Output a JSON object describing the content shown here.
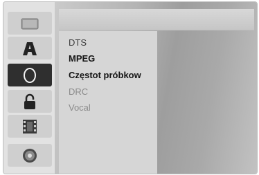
{
  "sidebar": {
    "items": [
      {
        "icon": "folder-icon",
        "active": false
      },
      {
        "icon": "audio-language-a-icon",
        "active": false
      },
      {
        "icon": "circle-audio-icon",
        "active": true
      },
      {
        "icon": "lock-icon",
        "active": false
      },
      {
        "icon": "film-strip-icon",
        "active": false
      },
      {
        "icon": "disc-icon",
        "active": false
      }
    ]
  },
  "submenu": {
    "items": [
      {
        "label": "DTS",
        "state": "enabled"
      },
      {
        "label": "MPEG",
        "state": "selected"
      },
      {
        "label": "Częstot próbkow",
        "state": "selected"
      },
      {
        "label": "DRC",
        "state": "disabled"
      },
      {
        "label": "Vocal",
        "state": "disabled"
      }
    ]
  }
}
